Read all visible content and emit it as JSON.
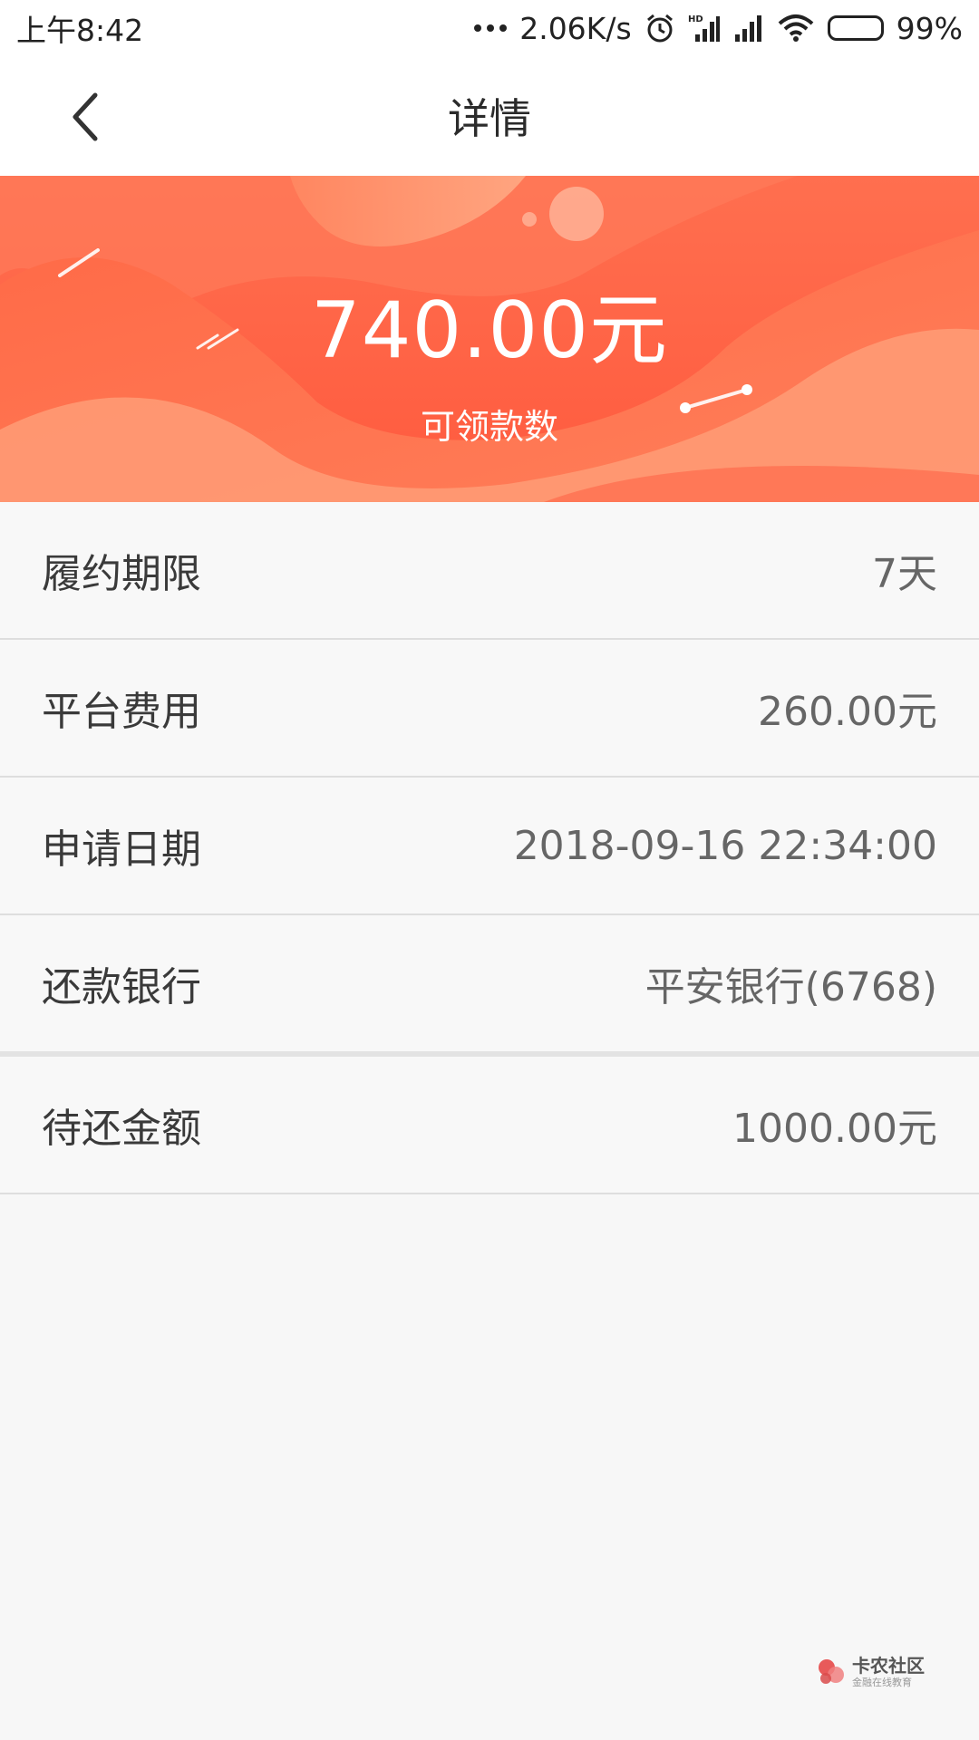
{
  "status_bar": {
    "time": "上午8:42",
    "network_speed": "2.06K/s",
    "battery_percent": "99%",
    "icons": [
      "more-dots-icon",
      "alarm-icon",
      "hd-signal-icon",
      "signal-icon",
      "wifi-icon",
      "battery-icon"
    ]
  },
  "nav": {
    "title": "详情",
    "back_icon": "chevron-left-icon"
  },
  "hero": {
    "amount": "740.00元",
    "label": "可领款数",
    "colors": {
      "primary": "#ff5a3e",
      "light": "#ff9a73"
    }
  },
  "details": [
    {
      "label": "履约期限",
      "value": "7天"
    },
    {
      "label": "平台费用",
      "value": "260.00元"
    },
    {
      "label": "申请日期",
      "value": "2018-09-16 22:34:00"
    },
    {
      "label": "还款银行",
      "value": "平安银行(6768)"
    },
    {
      "label": "待还金额",
      "value": "1000.00元"
    }
  ],
  "watermark": {
    "title": "卡农社区",
    "subtitle": "金融在线教育"
  }
}
